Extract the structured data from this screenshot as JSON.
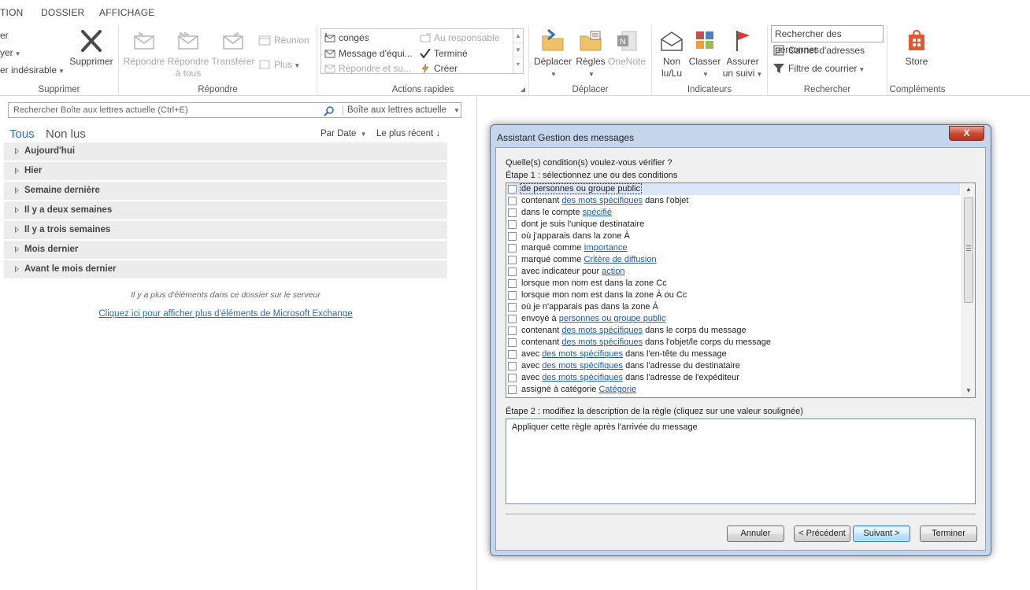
{
  "tabs": [
    "TION",
    "DOSSIER",
    "AFFICHAGE"
  ],
  "ribbon": {
    "supprimer": {
      "label": "Supprimer",
      "small": [
        "er",
        "yer",
        "er indésirable"
      ],
      "delete_button": "Supprimer"
    },
    "repondre": {
      "label": "Répondre",
      "reply": "Répondre",
      "reply_all_1": "Répondre",
      "reply_all_2": "à tous",
      "forward": "Transférer",
      "meeting": "Réunion",
      "more": "Plus"
    },
    "actions_rapides": {
      "label": "Actions rapides",
      "items": [
        "congés",
        "Message d'équi...",
        "Répondre et su...",
        "Au responsable",
        "Terminé",
        "Créer"
      ]
    },
    "deplacer": {
      "label": "Déplacer",
      "move": "Déplacer",
      "rules": "Règles",
      "onenote": "OneNote"
    },
    "indicateurs": {
      "label": "Indicateurs",
      "unread_1": "Non",
      "unread_2": "lu/Lu",
      "categorize": "Classer",
      "follow_1": "Assurer",
      "follow_2": "un suivi"
    },
    "rechercher": {
      "label": "Rechercher",
      "people_search": "Rechercher des personnes",
      "address_book": "Carnet d'adresses",
      "filter_email": "Filtre de courrier"
    },
    "complements": {
      "label": "Compléments",
      "store": "Store"
    }
  },
  "mail_list": {
    "search_placeholder": "Rechercher Boîte aux lettres actuelle (Ctrl+E)",
    "search_scope": "Boîte aux lettres actuelle",
    "filter_all": "Tous",
    "filter_unread": "Non lus",
    "sort_by": "Par Date",
    "sort_order": "Le plus récent",
    "groups": [
      "Aujourd'hui",
      "Hier",
      "Semaine dernière",
      "Il y a deux semaines",
      "Il y a trois semaines",
      "Mois dernier",
      "Avant le mois dernier"
    ],
    "more_items": "Il y a plus d'éléments dans ce dossier sur le serveur",
    "exchange_link": "Cliquez ici pour afficher plus d'éléments de Microsoft Exchange"
  },
  "dialog": {
    "title": "Assistant Gestion des messages",
    "close": "X",
    "question": "Quelle(s) condition(s) voulez-vous vérifier ?",
    "step1": "Étape 1 : sélectionnez une ou des conditions",
    "conditions": [
      {
        "pre": "de personnes ou groupe public",
        "link": "",
        "post": ""
      },
      {
        "pre": "contenant ",
        "link": "des mots spécifiques",
        "post": " dans l'objet"
      },
      {
        "pre": "dans le compte ",
        "link": "spécifié",
        "post": ""
      },
      {
        "pre": "dont je suis l'unique destinataire",
        "link": "",
        "post": ""
      },
      {
        "pre": "où j'apparais dans la zone À",
        "link": "",
        "post": ""
      },
      {
        "pre": "marqué comme ",
        "link": "Importance",
        "post": ""
      },
      {
        "pre": "marqué comme ",
        "link": "Critère de diffusion",
        "post": ""
      },
      {
        "pre": "avec indicateur pour ",
        "link": "action ",
        "post": ""
      },
      {
        "pre": "lorsque mon nom est dans la zone Cc",
        "link": "",
        "post": ""
      },
      {
        "pre": "lorsque mon nom est dans la zone À ou Cc",
        "link": "",
        "post": ""
      },
      {
        "pre": "où je n'apparais pas dans la zone À",
        "link": "",
        "post": ""
      },
      {
        "pre": "envoyé à ",
        "link": "personnes ou groupe public",
        "post": ""
      },
      {
        "pre": "contenant ",
        "link": "des mots spécifiques",
        "post": " dans le corps du message"
      },
      {
        "pre": "contenant ",
        "link": "des mots spécifiques",
        "post": " dans l'objet/le corps du message"
      },
      {
        "pre": "avec ",
        "link": "des mots spécifiques",
        "post": " dans l'en-tête du message"
      },
      {
        "pre": "avec ",
        "link": "des mots spécifiques",
        "post": " dans l'adresse du destinataire"
      },
      {
        "pre": "avec ",
        "link": "des mots spécifiques",
        "post": " dans l'adresse de l'expéditeur"
      },
      {
        "pre": "assigné à catégorie ",
        "link": "Catégorie",
        "post": ""
      }
    ],
    "step2": "Étape 2 : modifiez la description de la règle (cliquez sur une valeur soulignée)",
    "description": "Appliquer cette règle après l'arrivée du message",
    "buttons": {
      "cancel": "Annuler",
      "previous": "< Précédent",
      "next": "Suivant >",
      "finish": "Terminer"
    }
  }
}
